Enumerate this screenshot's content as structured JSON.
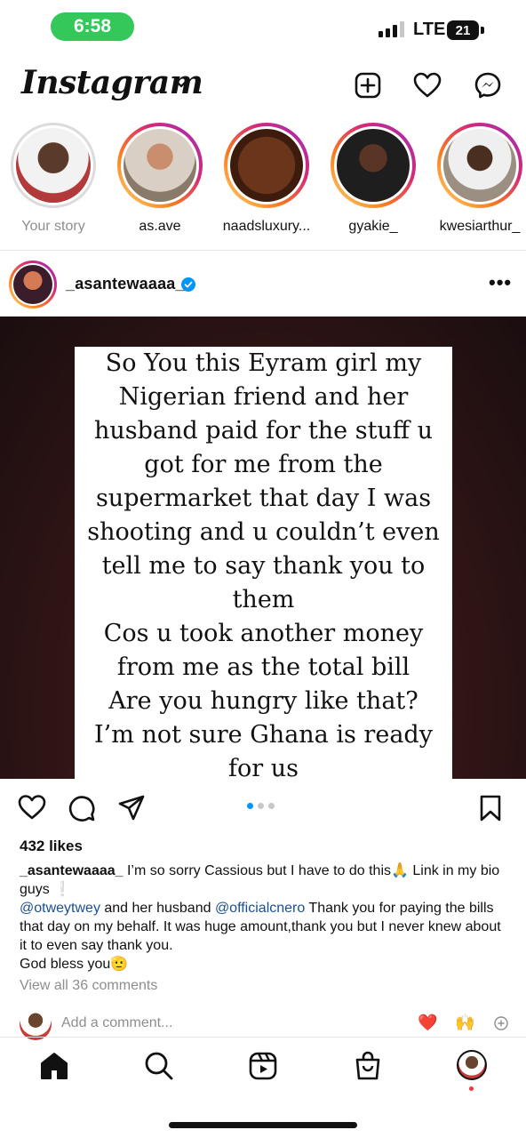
{
  "status_bar": {
    "time": "6:58",
    "network": "LTE",
    "battery": "21"
  },
  "header": {
    "logo": "Instagram"
  },
  "stories": [
    {
      "name": "Your story",
      "own": true,
      "color": "#e9e9e9"
    },
    {
      "name": "as.ave",
      "own": false,
      "color": "#c9b7a8"
    },
    {
      "name": "naadsluxury...",
      "own": false,
      "color": "#5a2d1a"
    },
    {
      "name": "gyakie_",
      "own": false,
      "color": "#2a2a2a"
    },
    {
      "name": "kwesiarthur_",
      "own": false,
      "color": "#8b7d6b"
    }
  ],
  "post": {
    "username": "_asantewaaaa_",
    "more": "•••",
    "image_text": "So You this Eyram girl my\nNigerian friend and her\nhusband paid for the stuff u\ngot for me from the\nsupermarket that day I was\nshooting and u couldn’t even\ntell me to say thank you to\nthem\nCos u took another money\nfrom me as the total bill\nAre you hungry like that?\nI’m not sure Ghana is ready\nfor us",
    "carousel": {
      "count": 3,
      "active": 1
    },
    "likes": "432 likes",
    "caption": {
      "user": "_asantewaaaa_",
      "line1": " I’m so sorry Cassious but I have to do this🙏 Link in my bio guys ❕",
      "mention1": "@otweytwey",
      "mid": " and her husband ",
      "mention2": "@officialcnero",
      "rest": " Thank you for paying the bills that day on my behalf. It was huge amount,thank you but I never knew about it to even say thank you.",
      "closing": "God bless you🫡"
    },
    "view_comments": "View all 36 comments",
    "comment_placeholder": "Add a comment...",
    "quick_reactions": [
      "❤️",
      "🙌"
    ]
  },
  "colors": {
    "mention": "#1a4f93",
    "status_green": "#34c759",
    "accent": "#0095f6"
  }
}
